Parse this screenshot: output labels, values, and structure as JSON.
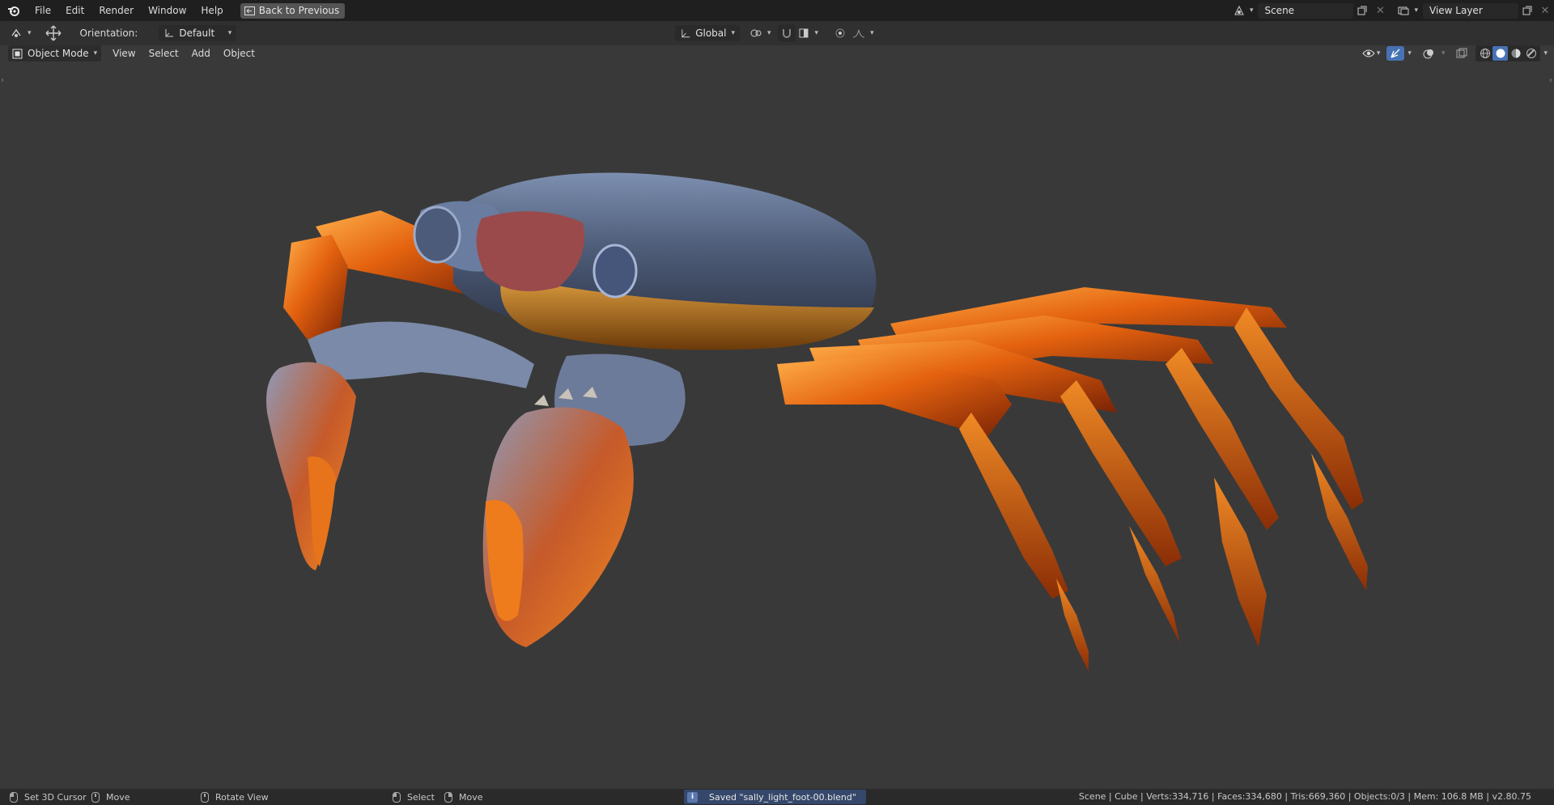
{
  "menu": {
    "items": [
      "File",
      "Edit",
      "Render",
      "Window",
      "Help"
    ],
    "back_button": "Back to Previous"
  },
  "topbar_right": {
    "scene_name": "Scene",
    "view_layer_name": "View Layer"
  },
  "tool_header": {
    "orientation_label": "Orientation:",
    "orientation_value": "Default",
    "transform_orientation": "Global"
  },
  "viewport_header": {
    "mode": "Object Mode",
    "menus": [
      "View",
      "Select",
      "Add",
      "Object"
    ],
    "shading_active": "solid"
  },
  "viewport": {
    "subject_icon": "crab-sculpt-model",
    "colors": {
      "shell": "#5d6f8e",
      "accent": "#e56a12",
      "background": "#393939"
    }
  },
  "statusbar": {
    "hints": [
      {
        "label": "Set 3D Cursor",
        "icon": "mouse-left-icon"
      },
      {
        "label": "Move",
        "icon": "mouse-middle-icon"
      },
      {
        "label": "Rotate View",
        "icon": "mouse-middle-icon"
      },
      {
        "label": "Select",
        "icon": "mouse-left-icon"
      },
      {
        "label": "Move",
        "icon": "mouse-right-icon"
      }
    ],
    "report": "Saved \"sally_light_foot-00.blend\"",
    "stats": "Scene | Cube | Verts:334,716 | Faces:334,680 | Tris:669,360 | Objects:0/3 | Mem: 106.8 MB | v2.80.75"
  }
}
